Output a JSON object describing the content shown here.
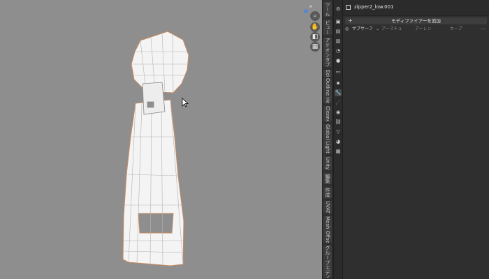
{
  "viewport": {
    "nav_buttons": [
      "zoom",
      "pan",
      "camera",
      "grid"
    ]
  },
  "npanel_tabs": [
    "ツール",
    "ビュー",
    "アドオンタブ",
    "Edit",
    "Outline Helper",
    "Cleaner",
    "Global Lighting",
    "Unity",
    "編集",
    "作成",
    "UVAT",
    "Mesh Offsetter",
    "グループエディタ"
  ],
  "props_tabs": [
    "tool",
    "render",
    "output",
    "view-layer",
    "scene",
    "world",
    "collection",
    "object",
    "modifier",
    "particles",
    "physics",
    "constraints",
    "data",
    "material",
    "texture"
  ],
  "properties": {
    "object_name": "zipper2_low.001",
    "add_modifier_label": "モディファイアーを追加",
    "modifier_row": {
      "subsurf": "サブサーフ",
      "armature": "アーマチュ",
      "array": "アーレン",
      "curve": "カーブ"
    }
  },
  "colors": {
    "viewport_bg": "#8e8e8e",
    "mesh_fill": "#f4f4f4",
    "mesh_edge": "#c98a5e",
    "panel_bg": "#2f2f2f"
  }
}
